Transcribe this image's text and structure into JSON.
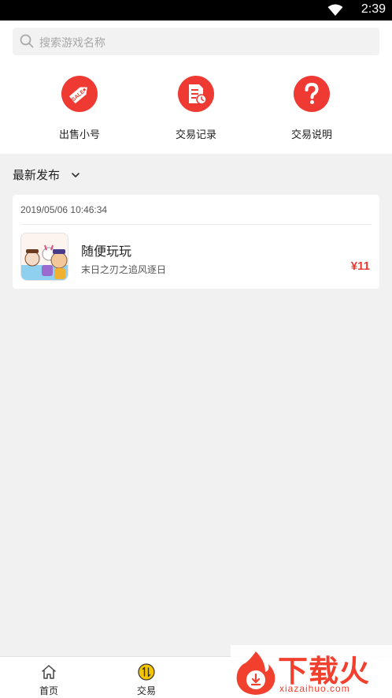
{
  "status_bar": {
    "time": "2:39"
  },
  "search": {
    "placeholder": "搜索游戏名称"
  },
  "quick_actions": [
    {
      "label": "出售小号",
      "icon": "sale-tag-icon",
      "badge": "SALE"
    },
    {
      "label": "交易记录",
      "icon": "trade-record-icon"
    },
    {
      "label": "交易说明",
      "icon": "question-icon"
    }
  ],
  "section": {
    "title": "最新发布"
  },
  "listings": [
    {
      "timestamp": "2019/05/06 10:46:34",
      "title": "随便玩玩",
      "subtitle": "末日之刃之追风逐日",
      "price": "¥11"
    }
  ],
  "bottom_nav": [
    {
      "label": "首页",
      "icon": "home-icon"
    },
    {
      "label": "交易",
      "icon": "trade-icon"
    }
  ],
  "watermark": {
    "title": "下载火",
    "url": "xiazaihuo.com"
  },
  "colors": {
    "accent": "#ee3a33",
    "trade_icon": "#f5c400",
    "background": "#f1f1f1"
  }
}
